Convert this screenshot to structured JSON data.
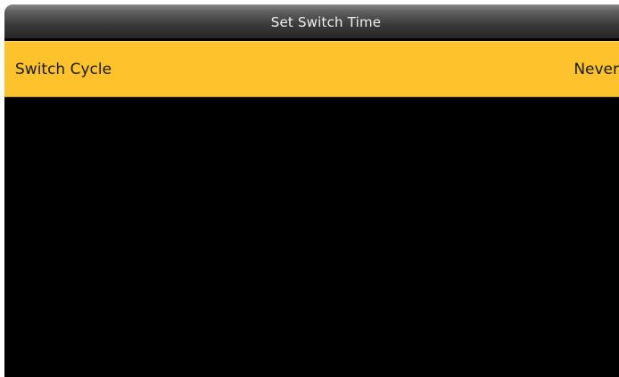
{
  "header": {
    "title": "Set Switch Time"
  },
  "menu": {
    "items": [
      {
        "label": "Switch Cycle",
        "value": "Never",
        "selected": true
      }
    ]
  },
  "colors": {
    "highlight": "#fec32b",
    "background": "#000000",
    "title_text": "#f0f0f0",
    "item_text": "#1a1a1a"
  }
}
